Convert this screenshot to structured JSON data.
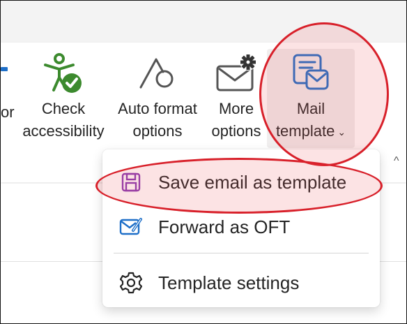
{
  "ribbon": {
    "partial_label": "or",
    "check_accessibility": {
      "line1": "Check",
      "line2": "accessibility",
      "icon": "accessibility-check-icon"
    },
    "auto_format": {
      "line1": "Auto format",
      "line2": "options",
      "icon": "auto-format-icon"
    },
    "more_options": {
      "line1": "More",
      "line2": "options",
      "icon": "envelope-gear-icon"
    },
    "mail_template": {
      "line1": "Mail",
      "line2": "template",
      "icon": "mail-template-icon",
      "chevron": "⌄"
    },
    "collapse_caret": "^"
  },
  "menu": {
    "items": [
      {
        "label": "Save email as template",
        "icon": "save-icon",
        "icon_color": "#8a3bb3"
      },
      {
        "label": "Forward as OFT",
        "icon": "envelope-edit-icon",
        "icon_color": "#1e6fc8"
      },
      {
        "label": "Template settings",
        "icon": "gear-icon",
        "icon_color": "#242424"
      }
    ]
  },
  "colors": {
    "accent_blue": "#1e6fc8",
    "check_green": "#3c8a2e",
    "highlight_red": "#d8202a"
  }
}
